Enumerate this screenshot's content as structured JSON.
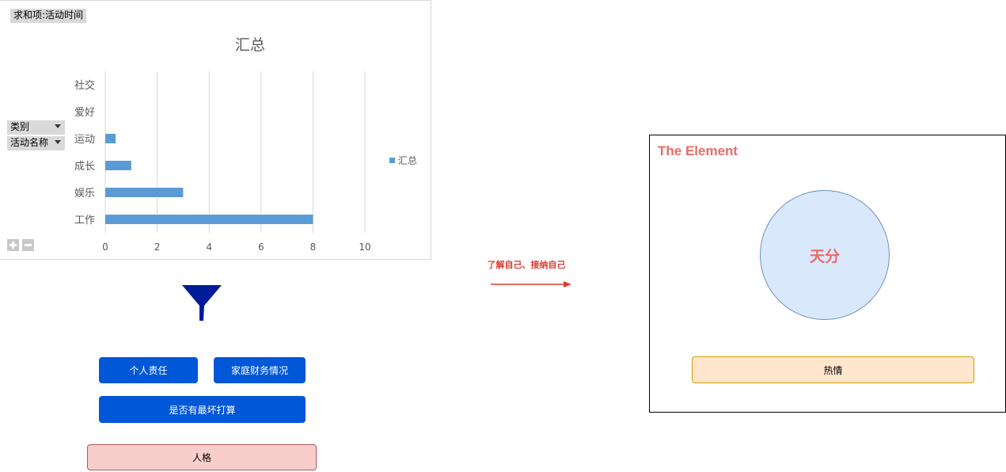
{
  "pivot": {
    "value_field": "求和项:活动时间",
    "row_fields": [
      "类别",
      "活动名称"
    ]
  },
  "chart_data": {
    "type": "bar",
    "orientation": "horizontal",
    "title": "汇总",
    "categories": [
      "社交",
      "爱好",
      "运动",
      "成长",
      "娱乐",
      "工作"
    ],
    "series": [
      {
        "name": "汇总",
        "values": [
          0,
          0,
          0.4,
          1,
          3,
          8
        ]
      }
    ],
    "xlim": [
      0,
      10
    ],
    "xticks": [
      0,
      2,
      4,
      6,
      8,
      10
    ],
    "grid": true,
    "legend": "right",
    "colors": {
      "bar": "#5b9bd5"
    }
  },
  "factors": {
    "personal_responsibility": "个人责任",
    "family_finance": "家庭财务情况",
    "worst_case_plan": "是否有最坏打算",
    "personality": "人格"
  },
  "arrow": {
    "label": "了解自己、接纳自己",
    "color": "#e03c31"
  },
  "element": {
    "title": "The Element",
    "talent": "天分",
    "passion": "热情"
  }
}
